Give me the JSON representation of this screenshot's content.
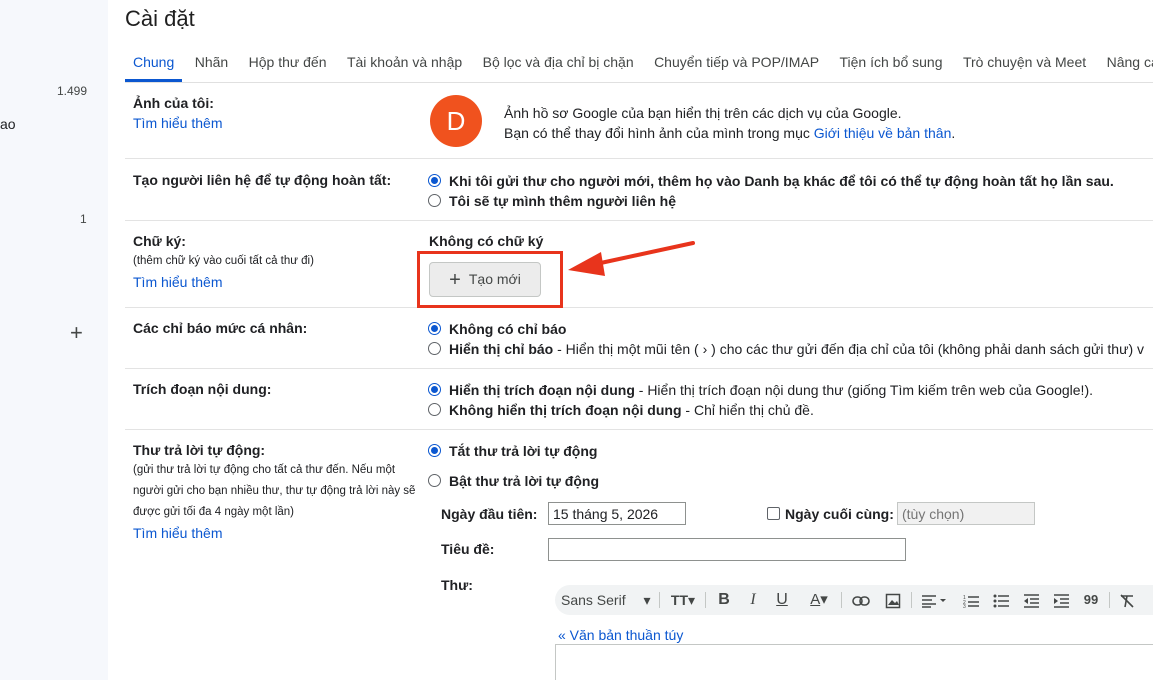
{
  "left_rail": {
    "count_1": "1.499",
    "partial_label": "ao",
    "count_2": "1",
    "add_icon": "plus-icon"
  },
  "page_title": "Cài đặt",
  "tabs": [
    {
      "label": "Chung",
      "active": true
    },
    {
      "label": "Nhãn"
    },
    {
      "label": "Hộp thư đến"
    },
    {
      "label": "Tài khoản và nhập"
    },
    {
      "label": "Bộ lọc và địa chỉ bị chặn"
    },
    {
      "label": "Chuyển tiếp và POP/IMAP"
    },
    {
      "label": "Tiện ích bổ sung"
    },
    {
      "label": "Trò chuyện và Meet"
    },
    {
      "label": "Nâng cao"
    }
  ],
  "photo": {
    "label": "Ảnh của tôi:",
    "learn_more": "Tìm hiểu thêm",
    "avatar_letter": "D",
    "line1": "Ảnh hồ sơ Google của bạn hiển thị trên các dịch vụ của Google.",
    "line2_prefix": "Bạn có thể thay đổi hình ảnh của mình trong mục ",
    "line2_link": "Giới thiệu về bản thân",
    "line2_suffix": "."
  },
  "autocomplete": {
    "label": "Tạo người liên hệ để tự động hoàn tất:",
    "option1": "Khi tôi gửi thư cho người mới, thêm họ vào Danh bạ khác để tôi có thể tự động hoàn tất họ lần sau.",
    "option2": "Tôi sẽ tự mình thêm người liên hệ"
  },
  "signature": {
    "label": "Chữ ký:",
    "sub": "(thêm chữ ký vào cuối tất cả thư đi)",
    "learn_more": "Tìm hiểu thêm",
    "none": "Không có chữ ký",
    "create_button": "Tạo mới"
  },
  "indicators": {
    "label": "Các chỉ báo mức cá nhân:",
    "option1": "Không có chỉ báo",
    "option2_bold": "Hiển thị chỉ báo",
    "option2_rest": " - Hiển thị một mũi tên ( › ) cho các thư gửi đến địa chỉ của tôi (không phải danh sách gửi thư) v"
  },
  "snippets": {
    "label": "Trích đoạn nội dung:",
    "option1_bold": "Hiển thị trích đoạn nội dung",
    "option1_rest": " - Hiển thị trích đoạn nội dung thư (giống Tìm kiếm trên web của Google!).",
    "option2_bold": "Không hiển thị trích đoạn nội dung",
    "option2_rest": " - Chỉ hiển thị chủ đề."
  },
  "vacation": {
    "label": "Thư trả lời tự động:",
    "sub1": "(gửi thư trả lời tự động cho tất cả thư đến. Nếu một",
    "sub2": "người gửi cho bạn nhiều thư, thư tự động trả lời này sẽ",
    "sub3": "được gửi tối đa 4 ngày một lần)",
    "learn_more": "Tìm hiểu thêm",
    "option_off": "Tắt thư trả lời tự động",
    "option_on": "Bật thư trả lời tự động",
    "first_day_label": "Ngày đầu tiên:",
    "first_day_value": "15 tháng 5, 2026",
    "last_day_label": "Ngày cuối cùng:",
    "last_day_placeholder": "(tùy chọn)",
    "subject_label": "Tiêu đề:",
    "subject_value": "",
    "message_label": "Thư:",
    "font_select": "Sans Serif",
    "plain_text_link": "« Văn bản thuần túy"
  },
  "colors": {
    "accent": "#0b57d0",
    "highlight": "#e8341c",
    "avatar": "#f0521e"
  }
}
